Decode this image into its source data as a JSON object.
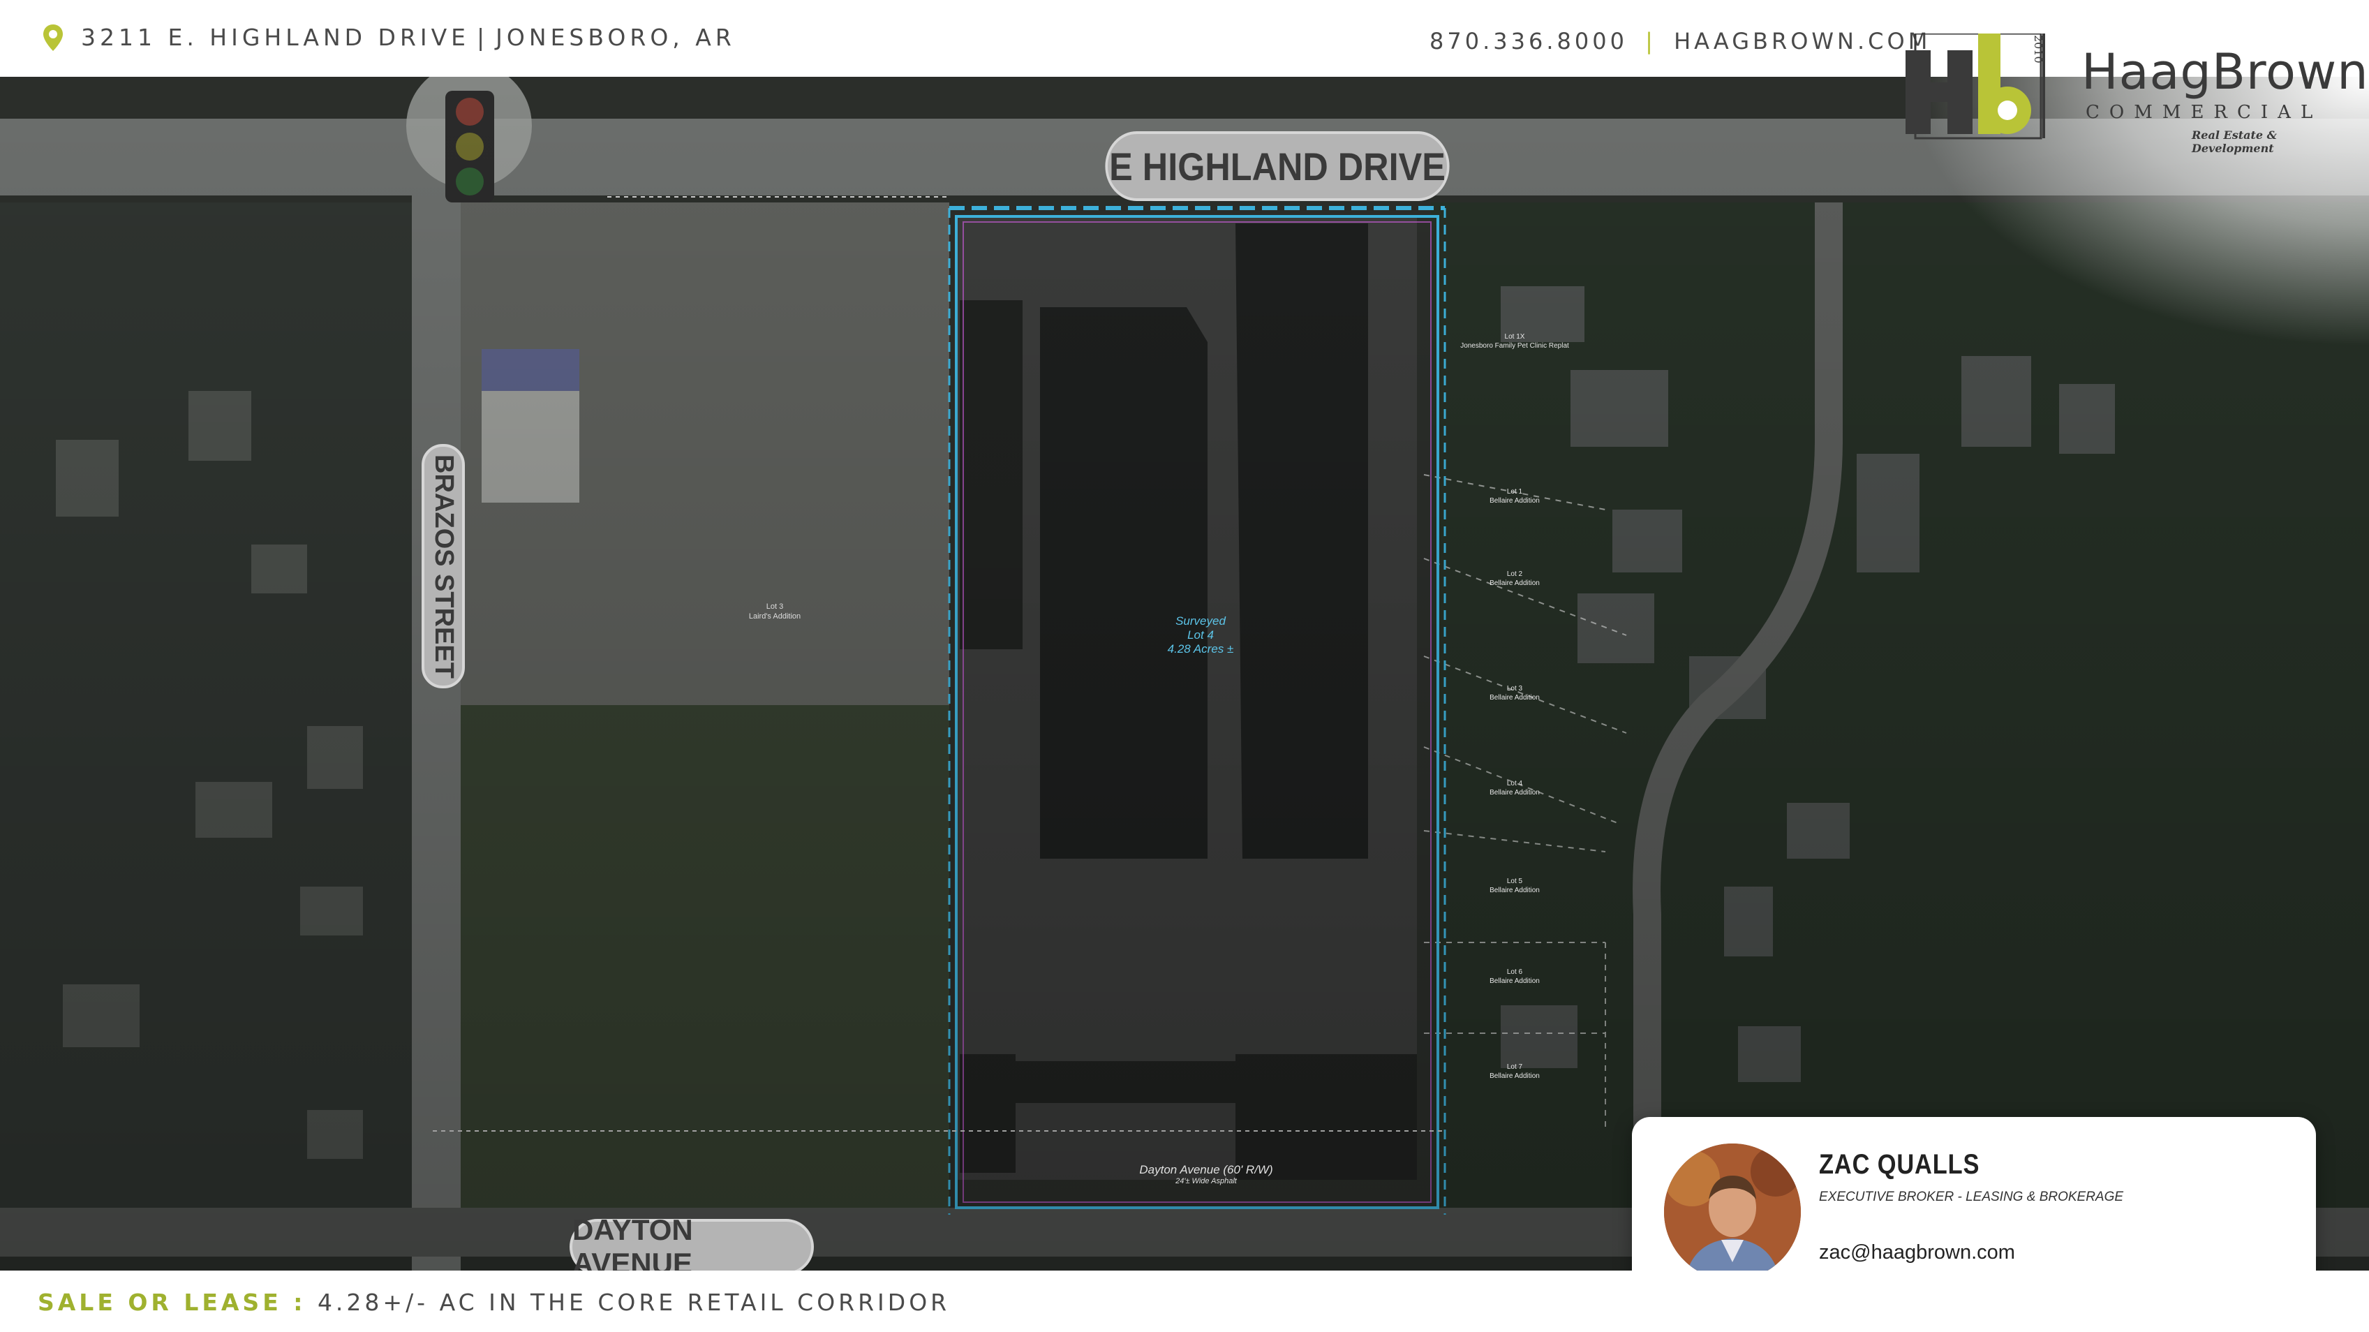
{
  "header": {
    "address": "3211 E. HIGHLAND DRIVE",
    "city": "JONESBORO, AR",
    "phone": "870.336.8000",
    "website": "HAAGBROWN.COM",
    "divider": "|"
  },
  "brand": {
    "name": "HaagBrown",
    "sub": "COMMERCIAL",
    "tagline": "Real Estate & Development",
    "year": "2010",
    "mark_letters": "Hb",
    "accent": "#b9c437"
  },
  "map": {
    "streets": {
      "north": "E HIGHLAND DRIVE",
      "west": "BRAZOS STREET",
      "south": "DAYTON AVENUE"
    },
    "plat_street": "Dayton Avenue (60' R/W)",
    "plat_street_sub": "24'± Wide Asphalt",
    "surveyed_lot": {
      "line1": "Surveyed",
      "line2": "Lot 4",
      "line3": "4.28 Acres ±"
    },
    "west_lot": {
      "line1": "Lot 3",
      "line2": "Laird's Addition"
    },
    "east_lots": [
      {
        "lot": "Lot 1X",
        "addition": "Jonesboro Family Pet Clinic Replat"
      },
      {
        "lot": "Lot 1",
        "addition": "Bellaire Addition"
      },
      {
        "lot": "Lot 2",
        "addition": "Bellaire Addition"
      },
      {
        "lot": "Lot 3",
        "addition": "Bellaire Addition"
      },
      {
        "lot": "Lot 4",
        "addition": "Bellaire Addition"
      },
      {
        "lot": "Lot 5",
        "addition": "Bellaire Addition"
      },
      {
        "lot": "Lot 6",
        "addition": "Bellaire Addition"
      },
      {
        "lot": "Lot 7",
        "addition": "Bellaire Addition"
      }
    ]
  },
  "broker": {
    "name": "ZAC QUALLS",
    "title": "EXECUTIVE BROKER - LEASING & BROKERAGE",
    "email": "zac@haagbrown.com"
  },
  "footer": {
    "label": "SALE OR LEASE",
    "colon": " : ",
    "text": "4.28+/- AC IN THE CORE RETAIL CORRIDOR"
  },
  "colors": {
    "accent_green": "#b9c437",
    "survey_line": "#3fb6e0",
    "lot_label": "#5cc4e8"
  }
}
